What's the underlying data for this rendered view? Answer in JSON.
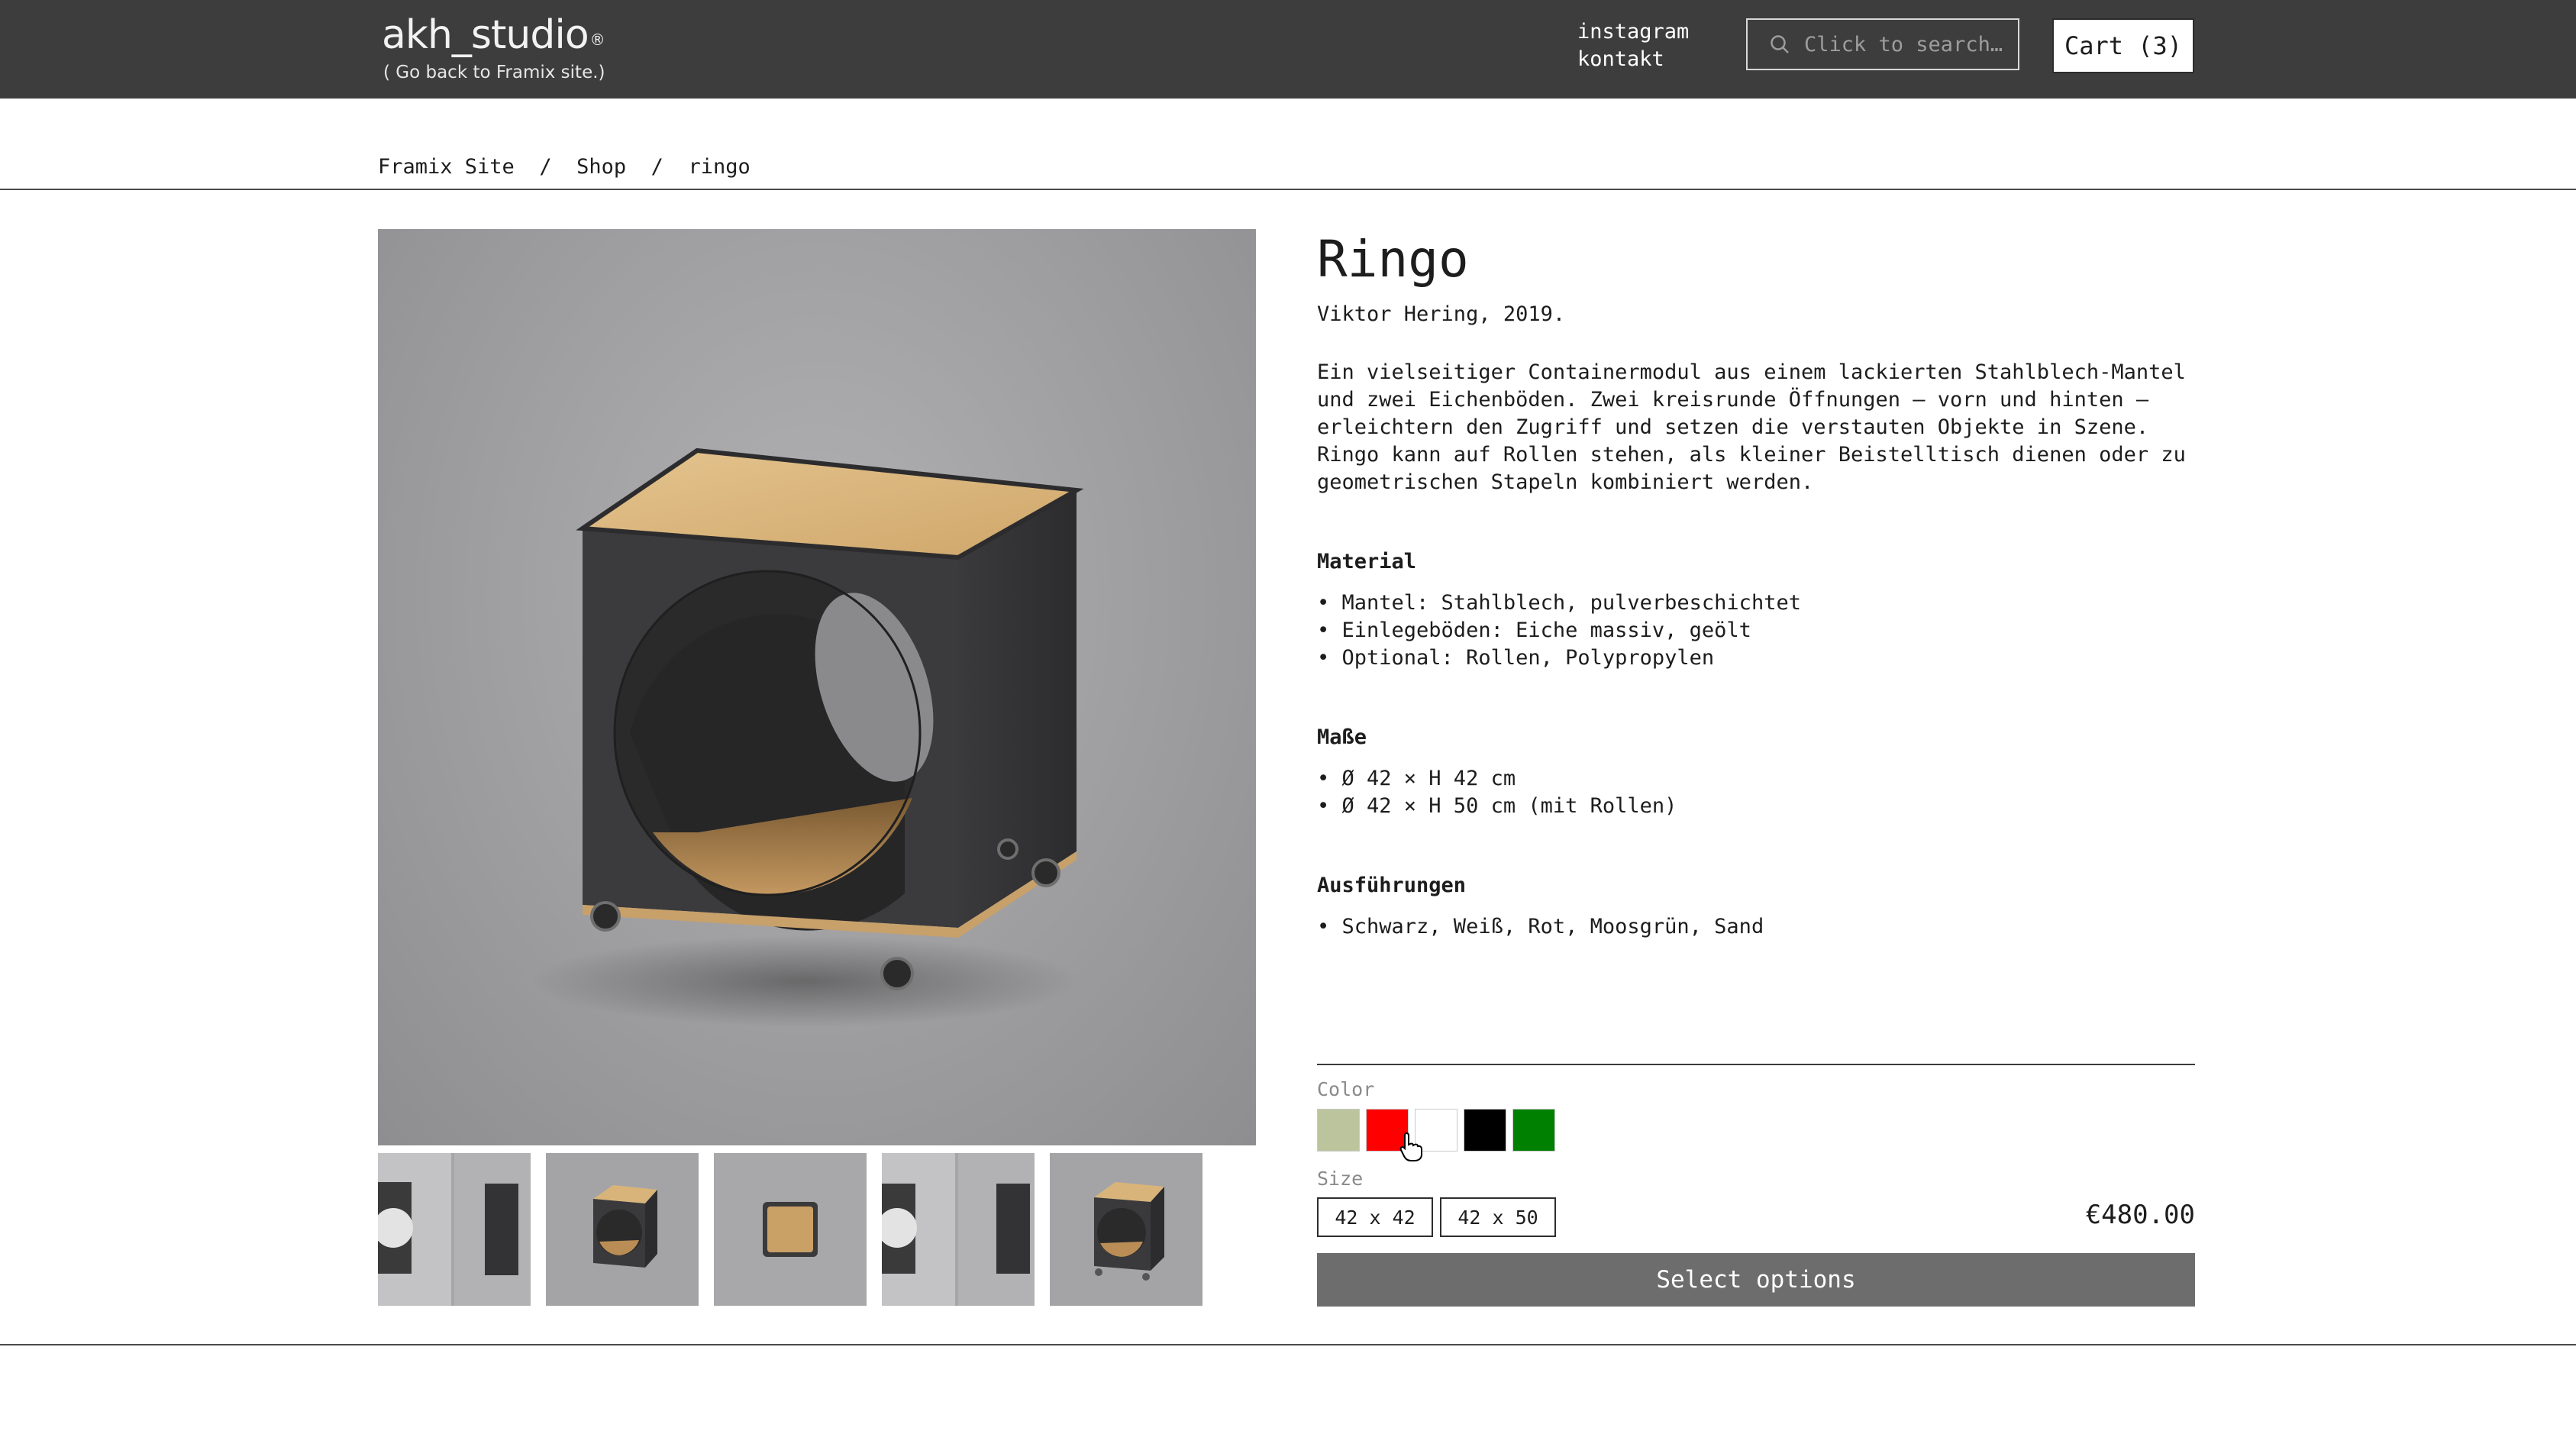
{
  "header": {
    "logo_word": "akh_studio",
    "logo_mark": "®",
    "logo_back": "( Go back to Framix site.)",
    "links": [
      "instagram",
      "kontakt"
    ],
    "search_placeholder": "Click to search…",
    "search_icon": "search-icon",
    "cart_label": "Cart (3)"
  },
  "breadcrumb": [
    "Framix Site",
    "Shop",
    "ringo"
  ],
  "breadcrumb_separator": "/",
  "product": {
    "title": "Ringo",
    "author": "Viktor Hering, 2019.",
    "description": "Ein vielseitiger Containermodul aus einem lackierten Stahlblech-Mantel und zwei Eichenböden. Zwei kreisrunde Öffnungen — vorn und hinten — erleichtern den Zugriff und setzen die verstauten Objekte in Szene. Ringo kann auf Rollen stehen, als kleiner Beistelltisch dienen oder zu geometrischen Stapeln kombiniert werden.",
    "sections": [
      {
        "title": "Material",
        "items": [
          "• Mantel: Stahlblech, pulverbeschichtet",
          "• Einlegeböden: Eiche massiv, geölt",
          "• Optional: Rollen, Polypropylen"
        ]
      },
      {
        "title": "Maße",
        "items": [
          "• Ø 42 × H 42 cm",
          "• Ø 42 × H 50 cm (mit Rollen)"
        ]
      },
      {
        "title": "Ausführungen",
        "items": [
          "• Schwarz, Weiß, Rot, Moosgrün, Sand"
        ]
      }
    ]
  },
  "options": {
    "color_label": "Color",
    "colors": [
      "#bcc49e",
      "#ff0000",
      "#ffffff",
      "#000000",
      "#008000"
    ],
    "size_label": "Size",
    "sizes": [
      "42 x 42",
      "42 x 50"
    ]
  },
  "price": "€480.00",
  "cta_label": "Select options",
  "colors": {
    "header_bg": "#3d3d3d",
    "cta_bg": "#6d6d6d",
    "steel": "#3a3a3a",
    "oak": "#d9b47a"
  }
}
